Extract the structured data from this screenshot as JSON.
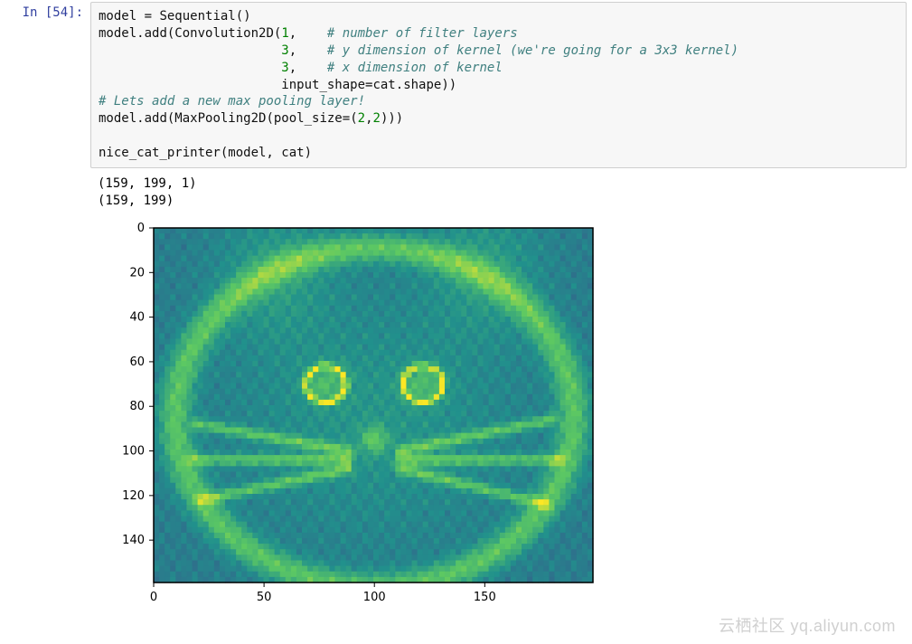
{
  "prompt": "In [54]:",
  "code": {
    "l1_a": "model ",
    "l1_b": "=",
    "l1_c": " Sequential()",
    "l2_a": "model",
    "l2_b": ".",
    "l2_c": "add(Convolution2D(",
    "l2_num": "1",
    "l2_sep": ",    ",
    "l2_comm": "# number of filter layers",
    "l3_pad": "                        ",
    "l3_num": "3",
    "l3_sep": ",    ",
    "l3_comm": "# y dimension of kernel (we're going for a 3x3 kernel)",
    "l4_pad": "                        ",
    "l4_num": "3",
    "l4_sep": ",    ",
    "l4_comm": "# x dimension of kernel",
    "l5_pad": "                        ",
    "l5_a": "input_shape",
    "l5_b": "=",
    "l5_c": "cat",
    "l5_d": ".",
    "l5_e": "shape))",
    "l6_comm": "# Lets add a new max pooling layer!",
    "l7_a": "model",
    "l7_b": ".",
    "l7_c": "add(MaxPooling2D(pool_size",
    "l7_d": "=",
    "l7_e": "(",
    "l7_n1": "2",
    "l7_f": ",",
    "l7_n2": "2",
    "l7_g": ")))",
    "l8": "",
    "l9": "nice_cat_printer(model, cat)"
  },
  "output": {
    "l1": "(159, 199, 1)",
    "l2": "(159, 199)"
  },
  "chart_data": {
    "type": "heatmap",
    "description": "matplotlib imshow of convolution+maxpool output (cat image, viridis-like colormap)",
    "y_ticks": [
      0,
      20,
      40,
      60,
      80,
      100,
      120,
      140
    ],
    "y_lim": [
      0,
      159
    ],
    "x_ticks": [
      0,
      50,
      100,
      150
    ],
    "x_lim": [
      0,
      199
    ],
    "image_shape": [
      159,
      199
    ],
    "colormap": "viridis",
    "note": "Pixel values are unlabeled; heatmap depicts a cat face/ears outline produced by the CNN filter."
  },
  "watermark": "云栖社区 yq.aliyun.com"
}
